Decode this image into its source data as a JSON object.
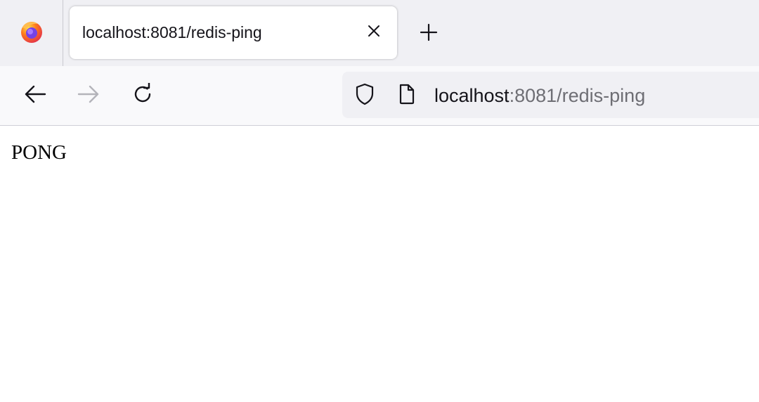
{
  "tab": {
    "title": "localhost:8081/redis-ping"
  },
  "urlbar": {
    "host": "localhost",
    "rest": ":8081/redis-ping"
  },
  "page": {
    "body_text": "PONG"
  },
  "icons": {
    "app_menu": "firefox-logo-icon",
    "tab_close": "close-icon",
    "new_tab": "plus-icon",
    "back": "arrow-left-icon",
    "forward": "arrow-right-icon",
    "reload": "reload-icon",
    "tracking": "shield-icon",
    "page_info": "document-icon"
  },
  "colors": {
    "tabstrip_bg": "#f0f0f4",
    "navbar_bg": "#f9f9fb",
    "urlbar_bg": "#f0f0f4",
    "text": "#15141a",
    "muted_text": "#6e6e74",
    "disabled_icon": "#b4b4ba"
  }
}
